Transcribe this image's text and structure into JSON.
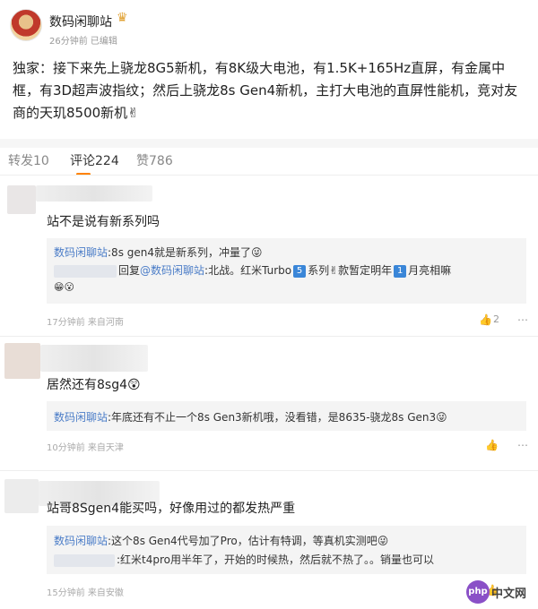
{
  "post": {
    "username": "数码闲聊站",
    "time": "26分钟前",
    "edited": "已编辑",
    "text": "独家：接下来先上骁龙8G5新机，有8K级大电池，有1.5K+165Hz直屏，有金属中框，有3D超声波指纹；然后上骁龙8s Gen4新机，主打大电池的直屏性能机，竞对友商的天玑8500新机✌"
  },
  "tabs": {
    "repost": "转发10",
    "comment": "评论224",
    "like": "赞786"
  },
  "comments": [
    {
      "text": "站不是说有新系列吗",
      "reply1_user": "数码闲聊站",
      "reply1_text": ":8s gen4就是新系列，冲量了😜",
      "reply2_prefix": "回复",
      "reply2_mention": "@数码闲聊站",
      "reply2_text_a": ":北战。红米Turbo",
      "reply2_badge1": "5",
      "reply2_text_b": "系列✌款暂定明年",
      "reply2_badge2": "1",
      "reply2_text_c": "月亮相嘛",
      "reply2_emoji": "😁😮",
      "time": "17分钟前",
      "location": "来自河南",
      "likes": "2"
    },
    {
      "text": "居然还有8sg4😲",
      "reply1_user": "数码闲聊站",
      "reply1_text": ":年底还有不止一个8s Gen3新机哦，没看错，是8635-骁龙8s Gen3😜",
      "time": "10分钟前",
      "location": "来自天津"
    },
    {
      "text": "站哥8Sgen4能买吗，好像用过的都发热严重",
      "reply1_user": "数码闲聊站",
      "reply1_text": ":这个8s Gen4代号加了Pro，估计有特调，等真机实测吧😜",
      "reply2_text": ":红米t4pro用半年了，开始的时候热，然后就不热了。。销量也可以",
      "time": "15分钟前",
      "location": "来自安徽"
    }
  ],
  "watermark": {
    "logo": "php",
    "text": "中文网"
  }
}
